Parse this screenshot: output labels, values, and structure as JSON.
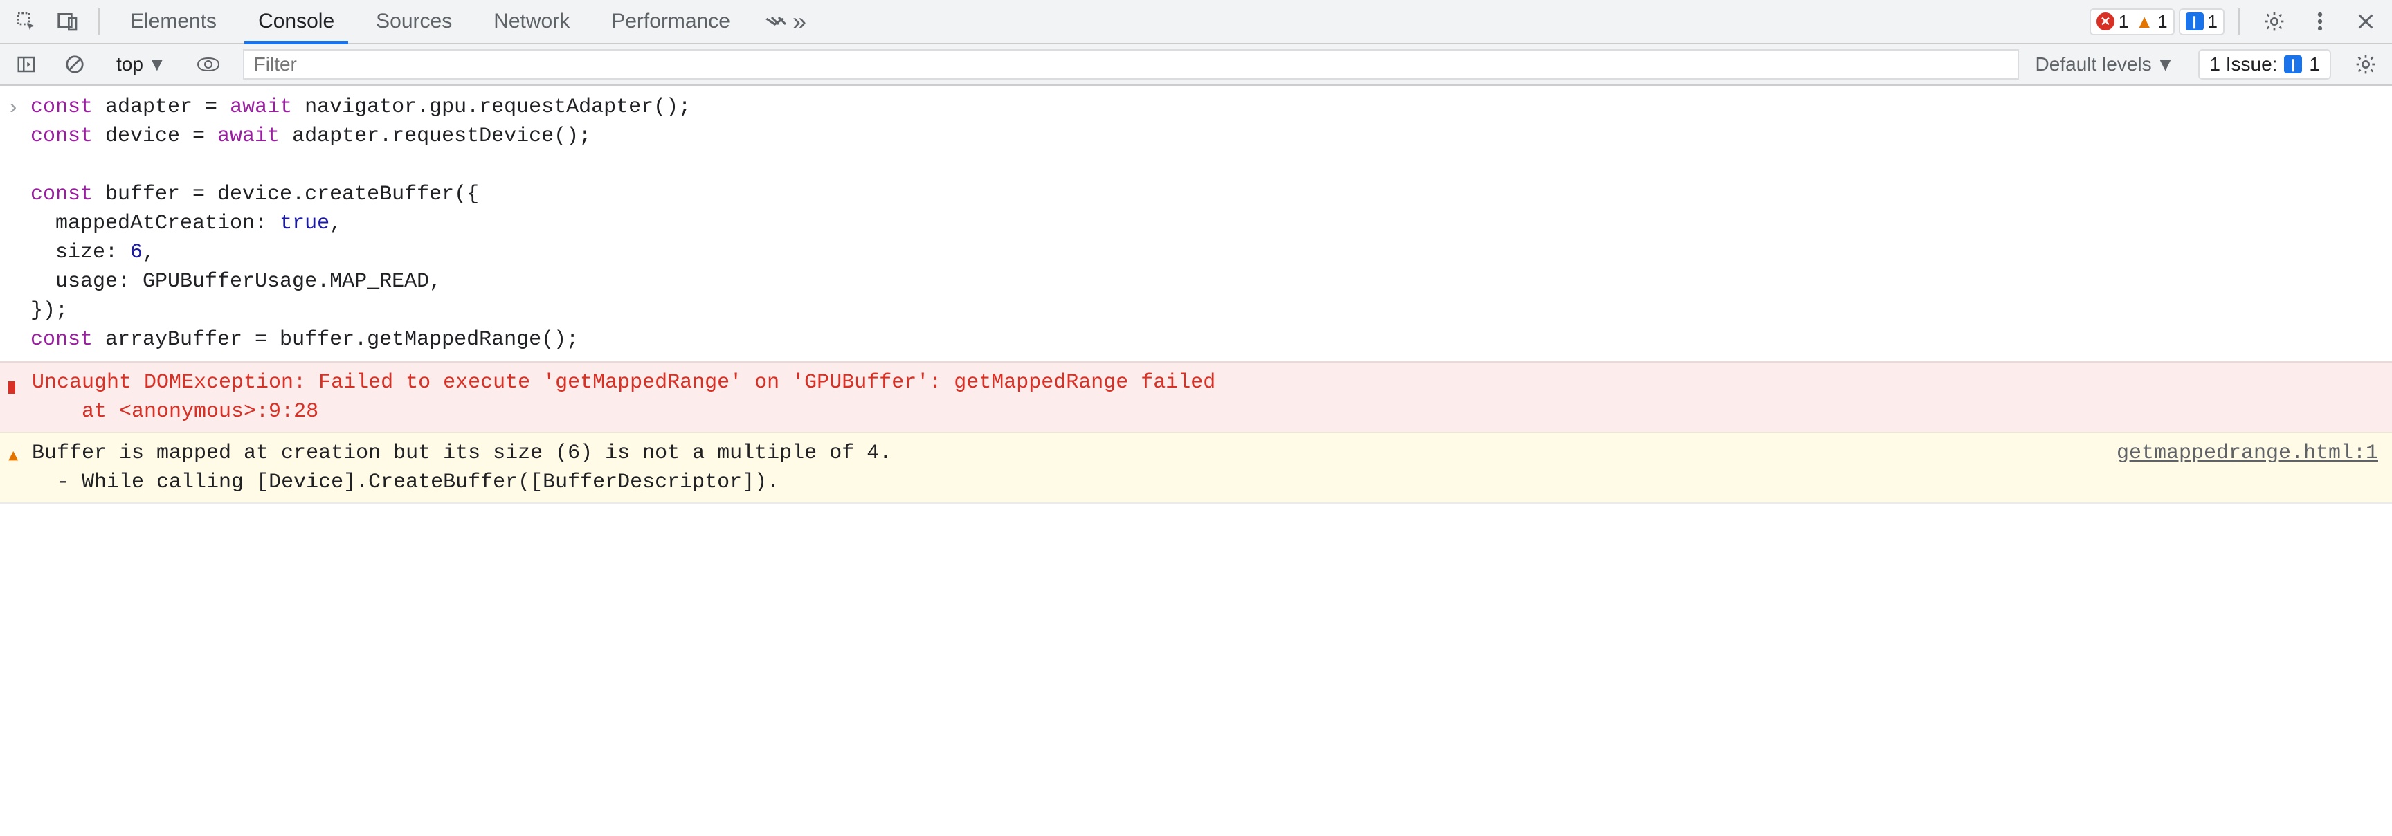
{
  "tabs": {
    "elements": "Elements",
    "console": "Console",
    "sources": "Sources",
    "network": "Network",
    "performance": "Performance"
  },
  "counts": {
    "errors": "1",
    "warnings": "1",
    "info": "1"
  },
  "subtoolbar": {
    "context": "top",
    "filter_placeholder": "Filter",
    "levels": "Default levels",
    "issues_label": "1 Issue:",
    "issues_count": "1"
  },
  "code": {
    "l1a": "const",
    "l1b": " adapter = ",
    "l1c": "await",
    "l1d": " navigator.gpu.requestAdapter();",
    "l2a": "const",
    "l2b": " device = ",
    "l2c": "await",
    "l2d": " adapter.requestDevice();",
    "l3": "",
    "l4a": "const",
    "l4b": " buffer = device.createBuffer({",
    "l5a": "  mappedAtCreation: ",
    "l5b": "true",
    "l5c": ",",
    "l6a": "  size: ",
    "l6b": "6",
    "l6c": ",",
    "l7": "  usage: GPUBufferUsage.MAP_READ,",
    "l8": "});",
    "l9a": "const",
    "l9b": " arrayBuffer = buffer.getMappedRange();"
  },
  "messages": {
    "error_text": "Uncaught DOMException: Failed to execute 'getMappedRange' on 'GPUBuffer': getMappedRange failed\n    at <anonymous>:9:28",
    "warn_text": "Buffer is mapped at creation but its size (6) is not a multiple of 4.\n  - While calling [Device].CreateBuffer([BufferDescriptor]).",
    "warn_src": "getmappedrange.html:1"
  }
}
